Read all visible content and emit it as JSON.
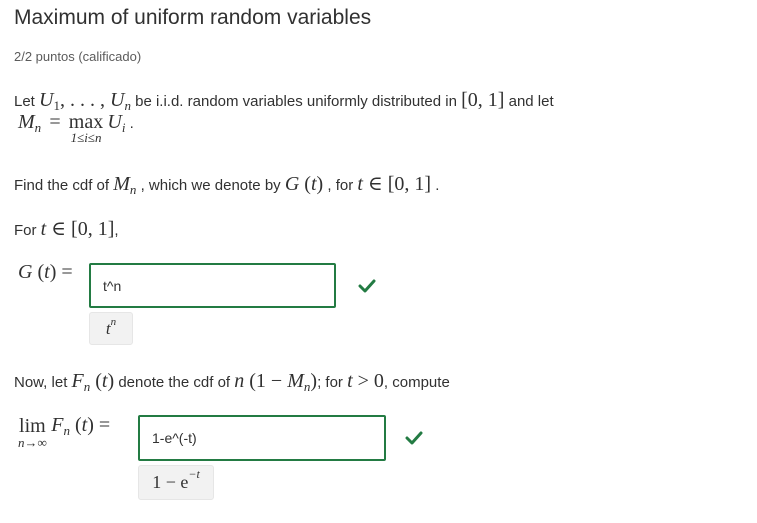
{
  "problem": {
    "title": "Maximum of uniform random variables",
    "score": "2/2 puntos (calificado)"
  },
  "intro": {
    "text1": "Let",
    "text2": "be i.i.d. random variables uniformly distributed in",
    "text3": "and let",
    "text4": "."
  },
  "find": {
    "text1": "Find the cdf of",
    "text2": ", which we denote by",
    "text3": ", for",
    "text4": "."
  },
  "for_line": {
    "text1": "For",
    "text2": ","
  },
  "answer1": {
    "input_value": "t^n",
    "preview_base": "t",
    "preview_exp": "n",
    "status": "correct"
  },
  "now": {
    "text1": "Now, let",
    "text2": "denote the cdf of",
    "text3": "; for",
    "text4": ", compute"
  },
  "answer2": {
    "input_value": "1-e^(-t)",
    "preview_main": "1 − e",
    "preview_exp": "−t",
    "status": "correct"
  },
  "colors": {
    "correct": "#237b43",
    "text": "#313131",
    "muted": "#5b5b5b"
  },
  "icons": {
    "correct": "check-icon"
  }
}
